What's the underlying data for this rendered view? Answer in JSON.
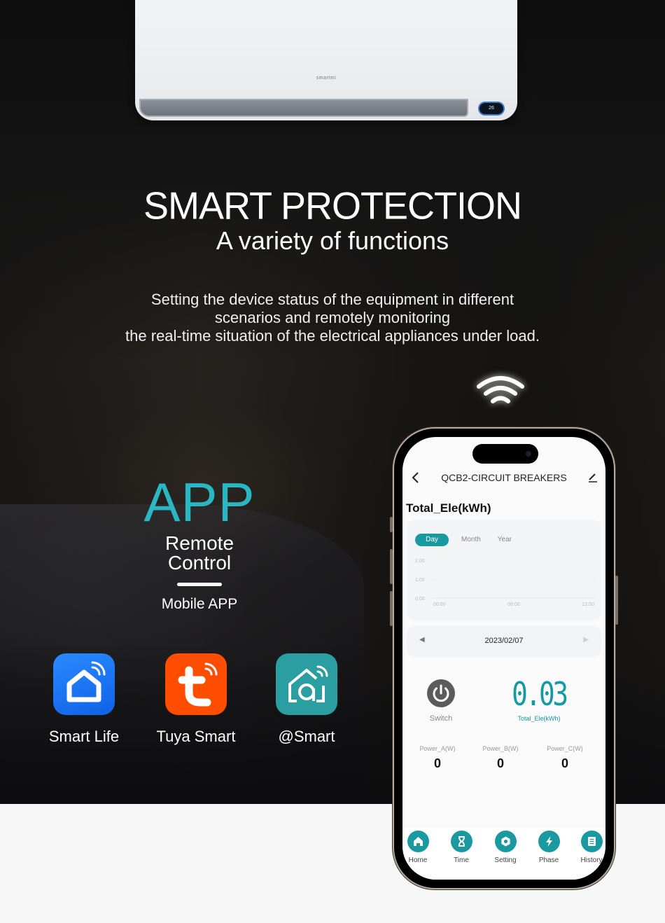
{
  "ac_unit": {
    "brand": "smartmi",
    "display": "26"
  },
  "hero": {
    "title": "SMART PROTECTION",
    "subtitle": "A variety of functions",
    "description_lines": [
      "Setting the device status of the equipment in different",
      "scenarios and remotely monitoring",
      "the real-time situation of the electrical appliances under load."
    ]
  },
  "app_section": {
    "title": "APP",
    "subtitle_line1": "Remote",
    "subtitle_line2": "Control",
    "caption": "Mobile APP",
    "accent_color": "#2ab7c3"
  },
  "store_apps": [
    {
      "label": "Smart Life",
      "icon": "smart-life-house-icon",
      "color": "#1a7cf5"
    },
    {
      "label": "Tuya Smart",
      "icon": "tuya-t-icon",
      "color": "#ff4d00"
    },
    {
      "label": "@Smart",
      "icon": "at-smart-house-icon",
      "color": "#2a9ea0"
    }
  ],
  "phone_app": {
    "header": {
      "title": "QCB2-CIRCUIT BREAKERS",
      "back_icon": "chevron-left-icon",
      "edit_icon": "pencil-icon"
    },
    "section_title": "Total_Ele(kWh)",
    "period_tabs": [
      {
        "label": "Day",
        "active": true
      },
      {
        "label": "Month",
        "active": false
      },
      {
        "label": "Year",
        "active": false
      }
    ],
    "date_nav": {
      "date": "2023/02/07",
      "prev_icon": "triangle-left-icon",
      "next_icon": "triangle-right-icon"
    },
    "switch": {
      "label": "Switch",
      "icon": "power-icon"
    },
    "total": {
      "value": "0.03",
      "label": "Total_Ele(kWh)"
    },
    "power": [
      {
        "label": "Power_A(W)",
        "value": "0"
      },
      {
        "label": "Power_B(W)",
        "value": "0"
      },
      {
        "label": "Power_C(W)",
        "value": "0"
      }
    ],
    "tabbar": [
      {
        "label": "Home",
        "icon": "home-icon"
      },
      {
        "label": "Time",
        "icon": "hourglass-icon"
      },
      {
        "label": "Setting",
        "icon": "settings-icon"
      },
      {
        "label": "Phase",
        "icon": "lightning-icon"
      },
      {
        "label": "History",
        "icon": "document-icon"
      }
    ],
    "accent_color": "#1a9aa0"
  },
  "chart_data": {
    "type": "line",
    "title": "",
    "xlabel": "",
    "ylabel": "",
    "x_ticks": [
      "00:00",
      "06:00",
      "12:00"
    ],
    "y_ticks": [
      "0.00",
      "1.00",
      "2.00"
    ],
    "ylim": [
      0,
      2
    ],
    "grid": true,
    "series": []
  }
}
